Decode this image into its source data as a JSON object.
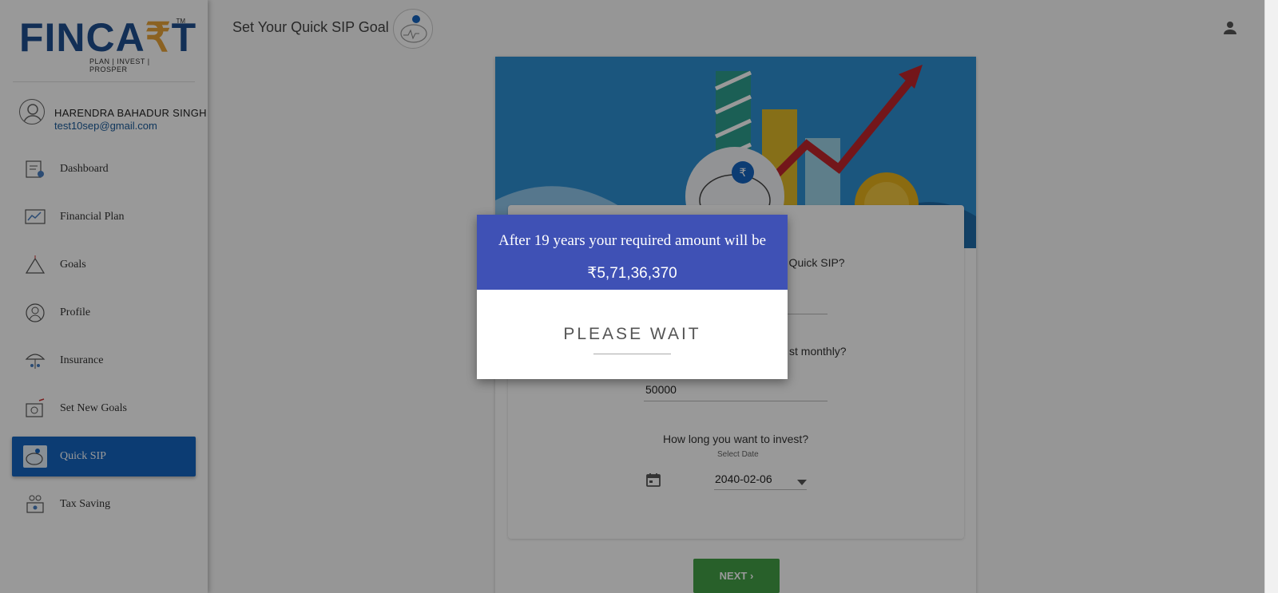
{
  "brand": {
    "logo_main": "FINCA",
    "logo_accent": "₹",
    "logo_tail": "T",
    "logo_tm": "TM",
    "logo_tagline": "PLAN | INVEST | PROSPER"
  },
  "user": {
    "name": "HARENDRA BAHADUR SINGH",
    "email": "test10sep@gmail.com"
  },
  "sidebar": {
    "items": [
      {
        "label": "Dashboard",
        "icon": "dashboard-icon",
        "active": false
      },
      {
        "label": "Financial Plan",
        "icon": "financial-plan-icon",
        "active": false
      },
      {
        "label": "Goals",
        "icon": "goals-icon",
        "active": false
      },
      {
        "label": "Profile",
        "icon": "profile-icon",
        "active": false
      },
      {
        "label": "Insurance",
        "icon": "insurance-icon",
        "active": false
      },
      {
        "label": "Set New Goals",
        "icon": "set-new-goals-icon",
        "active": false
      },
      {
        "label": "Quick SIP",
        "icon": "quick-sip-icon",
        "active": true
      },
      {
        "label": "Tax Saving",
        "icon": "tax-saving-icon",
        "active": false
      }
    ]
  },
  "header": {
    "title": "Set Your Quick SIP Goal"
  },
  "form": {
    "q1_visible": "r Quick SIP?",
    "q2_visible": "st monthly?",
    "monthly_value": "50000",
    "q3": "How long you want to invest?",
    "date_label": "Select Date",
    "date_value": "2040-02-06",
    "next_label": "NEXT"
  },
  "dialog": {
    "title": "After 19 years your required amount will be",
    "amount": "₹5,71,36,370",
    "wait_text": "PLEASE WAIT"
  },
  "colors": {
    "primary": "#1565c0",
    "dialog_header": "#3f51b5",
    "next_button": "#43a047",
    "banner": "#2e8fd3"
  }
}
